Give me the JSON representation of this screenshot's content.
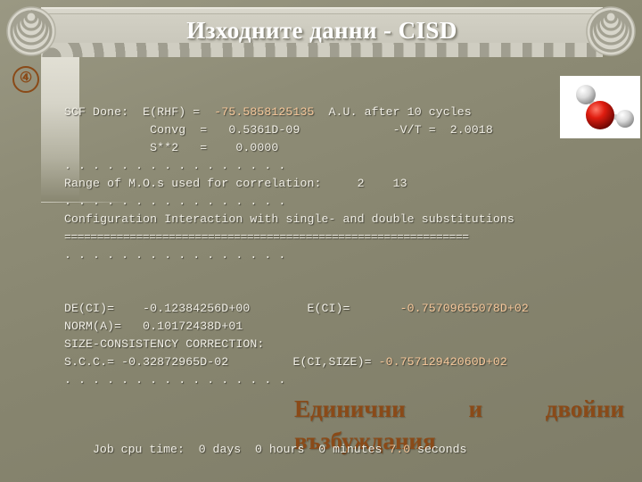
{
  "slide": {
    "title": "Изходните данни - CISD",
    "slide_number": "④",
    "accent_color": "#8a4a18",
    "highlight_color": "#f6c79a",
    "background_color": "#87856f",
    "titlebar_color": "#cfcdc1",
    "text_color": "#f1efe6"
  },
  "decorations": {
    "left_volute": "spiral-icon",
    "right_volute": "spiral-icon",
    "scallop_row": "dentil-arches",
    "molecule_image": "water-molecule-h2o"
  },
  "console": {
    "lines": [
      {
        "id": "scf-done",
        "segments": [
          {
            "text": "SCF Done:  E(RHF) =  ",
            "hl": false
          },
          {
            "text": "-75.5858125135",
            "hl": true
          },
          {
            "text": "  A.U. after 10 cycles",
            "hl": false
          }
        ]
      },
      {
        "id": "convg",
        "segments": [
          {
            "text": "            Convg  =   0.5361D-09             -V/T =  2.0018",
            "hl": false
          }
        ]
      },
      {
        "id": "s-squared",
        "segments": [
          {
            "text": "            S**2   =    0.0000",
            "hl": false
          }
        ]
      },
      {
        "id": "dots-1",
        "segments": [
          {
            "text": ". . . . . . . . . . . . . . . .",
            "hl": false
          }
        ]
      },
      {
        "id": "mo-range",
        "segments": [
          {
            "text": "Range of M.O.s used for correlation:     2    13",
            "hl": false
          }
        ]
      },
      {
        "id": "dots-2",
        "segments": [
          {
            "text": ". . . . . . . . . . . . . . . .",
            "hl": false
          }
        ]
      },
      {
        "id": "ci-header",
        "segments": [
          {
            "text": "Configuration Interaction with single- and double substitutions",
            "hl": false
          }
        ]
      },
      {
        "id": "equals-rule",
        "segments": [
          {
            "text": "==============================================================",
            "hl": false
          }
        ]
      },
      {
        "id": "dots-3",
        "segments": [
          {
            "text": ". . . . . . . . . . . . . . . .",
            "hl": false
          }
        ]
      },
      {
        "id": "blank-1",
        "segments": [
          {
            "text": " ",
            "hl": false
          }
        ]
      },
      {
        "id": "blank-2",
        "segments": [
          {
            "text": " ",
            "hl": false
          }
        ]
      },
      {
        "id": "de-ci",
        "segments": [
          {
            "text": "DE(CI)=    -0.12384256D+00        E(CI)=       ",
            "hl": false
          },
          {
            "text": "-0.75709655078D+02",
            "hl": true
          }
        ]
      },
      {
        "id": "norm-a",
        "segments": [
          {
            "text": "NORM(A)=   0.10172438D+01",
            "hl": false
          }
        ]
      },
      {
        "id": "scc-header",
        "segments": [
          {
            "text": "SIZE-CONSISTENCY CORRECTION:",
            "hl": false
          }
        ]
      },
      {
        "id": "scc-value",
        "segments": [
          {
            "text": "S.C.C.= -0.32872965D-02         E(CI,SIZE)= ",
            "hl": false
          },
          {
            "text": "-0.75712942060D+02",
            "hl": true
          }
        ]
      },
      {
        "id": "dots-4",
        "segments": [
          {
            "text": ". . . . . . . . . . . . . . . .",
            "hl": false
          }
        ]
      }
    ]
  },
  "caption": {
    "word_1": "Единични",
    "word_2": "и",
    "word_3": "двойни",
    "word_4": "възбуждания"
  },
  "jobtime": {
    "prefix": "Job cpu time:  0 days  0 hours  0 minutes ",
    "seconds": "7.0",
    "suffix": " seconds"
  }
}
